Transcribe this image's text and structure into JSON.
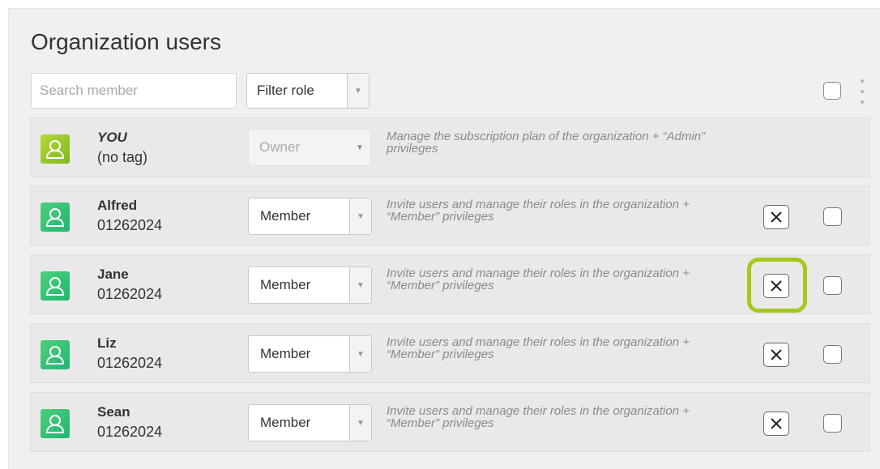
{
  "page": {
    "title": "Organization users"
  },
  "toolbar": {
    "search_placeholder": "Search member",
    "filter_label": "Filter role"
  },
  "members": [
    {
      "name": "YOU",
      "tag": "(no tag)",
      "role": "Owner",
      "description": "Manage the subscription plan of the organization + “Admin” privileges",
      "avatar_icon": "user-icon",
      "is_self": true
    },
    {
      "name": "Alfred",
      "tag": "01262024",
      "role": "Member",
      "description": "Invite users and manage their roles in the organization + “Member” privileges",
      "avatar_icon": "user-icon"
    },
    {
      "name": "Jane",
      "tag": "01262024",
      "role": "Member",
      "description": "Invite users and manage their roles in the organization + “Member” privileges",
      "avatar_icon": "user-icon",
      "highlighted": true
    },
    {
      "name": "Liz",
      "tag": "01262024",
      "role": "Member",
      "description": "Invite users and manage their roles in the organization + “Member” privileges",
      "avatar_icon": "user-icon"
    },
    {
      "name": "Sean",
      "tag": "01262024",
      "role": "Member",
      "description": "Invite users and manage their roles in the organization + “Member” privileges",
      "avatar_icon": "user-icon"
    }
  ],
  "colors": {
    "highlight": "#a4c81b",
    "owner_avatar": "#9bcb2c",
    "member_avatar": "#33c476"
  }
}
